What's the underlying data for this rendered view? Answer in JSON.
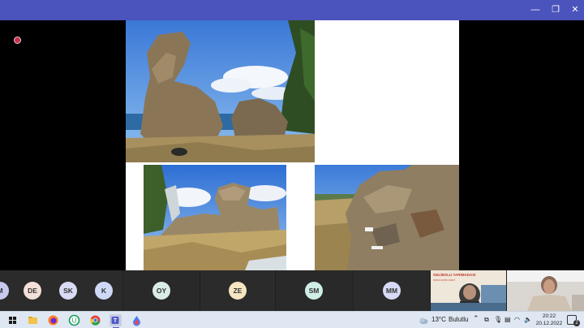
{
  "window": {
    "controls": {
      "minimize": "—",
      "restore": "❐",
      "close": "✕"
    }
  },
  "participants": [
    {
      "initials": "M",
      "color": "#c7c9f0"
    },
    {
      "initials": "DE",
      "color": "#f3e0d9"
    },
    {
      "initials": "SK",
      "color": "#d9dbf5"
    },
    {
      "initials": "K",
      "color": "#cfd8f5"
    },
    {
      "initials": "OY",
      "color": "#d9ede6"
    },
    {
      "initials": "ZE",
      "color": "#f5e5c0"
    },
    {
      "initials": "SM",
      "color": "#cfeee6"
    },
    {
      "initials": "MM",
      "color": "#d6daf5"
    }
  ],
  "video_poster": {
    "line1": "GELİBOLU YARIMADASI",
    "line2": "İKİNCİ ANTİK KENT"
  },
  "taskbar": {
    "weather_temp": "13°C",
    "weather_text": "Bulutlu",
    "time": "20:22",
    "date": "20.12.2022",
    "notification_count": "2"
  },
  "colors": {
    "titlebar": "#4b53bc",
    "accent": "#6264a7",
    "record": "#c4314b"
  }
}
